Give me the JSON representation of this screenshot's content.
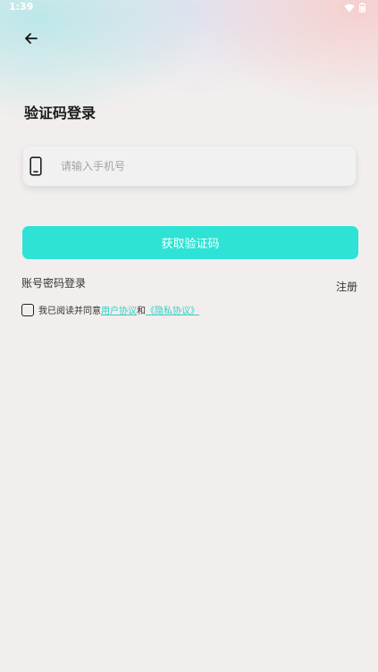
{
  "status_bar": {
    "time": "1:39",
    "wifi_icon": "wifi-icon",
    "battery_icon": "battery-icon"
  },
  "nav": {
    "back_icon": "arrow-left-icon"
  },
  "title": "验证码登录",
  "phone_field": {
    "icon": "phone-icon",
    "placeholder": "请输入手机号",
    "value": ""
  },
  "get_code_button": "获取验证码",
  "password_login_link": "账号密码登录",
  "register_link": "注册",
  "agreement": {
    "checked": false,
    "prefix": "我已阅读并同意",
    "user_agreement": "用户协议",
    "conjunction": "和",
    "privacy_policy": "《隐私协议》"
  },
  "colors": {
    "accent": "#2ee3d6",
    "link": "#2ed3c8",
    "background": "#f1eeed"
  }
}
